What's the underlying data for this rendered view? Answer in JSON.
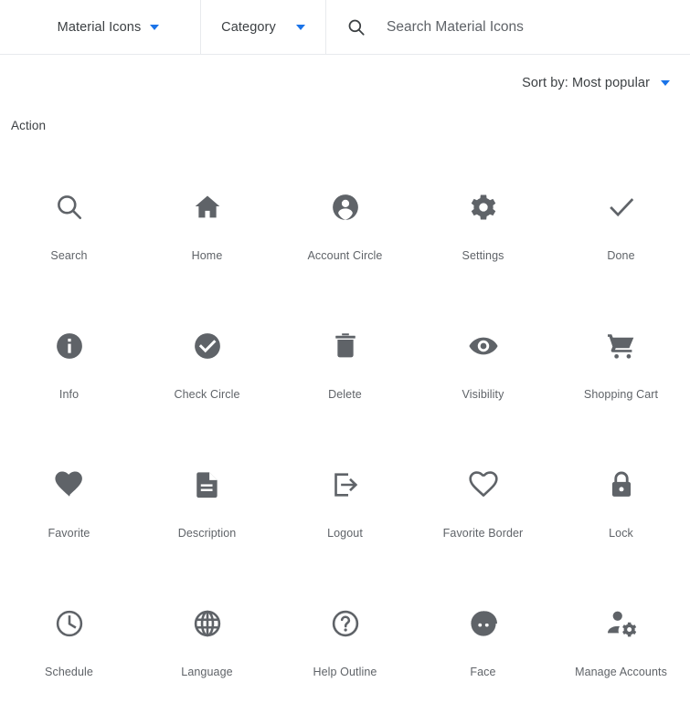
{
  "header": {
    "product_label": "Material Icons",
    "product_caret_icon": "chevron-down-icon",
    "category_label": "Category",
    "category_caret_icon": "chevron-down-icon",
    "search_icon": "search-icon",
    "search_value": "",
    "search_placeholder": "Search Material Icons"
  },
  "sort": {
    "label": "Sort by: Most popular",
    "caret_icon": "chevron-down-icon"
  },
  "section": {
    "title": "Action"
  },
  "colors": {
    "accent_blue": "#1a73e8",
    "icon_gray": "#5f6368",
    "text_gray": "#3c4043",
    "divider": "#e8eaed",
    "background": "#ffffff"
  },
  "icons": [
    {
      "label": "Search",
      "icon": "search-icon"
    },
    {
      "label": "Home",
      "icon": "home-icon"
    },
    {
      "label": "Account Circle",
      "icon": "account-circle-icon"
    },
    {
      "label": "Settings",
      "icon": "settings-gear-icon"
    },
    {
      "label": "Done",
      "icon": "checkmark-icon"
    },
    {
      "label": "Info",
      "icon": "info-filled-icon"
    },
    {
      "label": "Check Circle",
      "icon": "check-circle-filled-icon"
    },
    {
      "label": "Delete",
      "icon": "trash-can-icon"
    },
    {
      "label": "Visibility",
      "icon": "eye-icon"
    },
    {
      "label": "Shopping Cart",
      "icon": "shopping-cart-icon"
    },
    {
      "label": "Favorite",
      "icon": "heart-filled-icon"
    },
    {
      "label": "Description",
      "icon": "document-lines-icon"
    },
    {
      "label": "Logout",
      "icon": "logout-arrow-icon"
    },
    {
      "label": "Favorite Border",
      "icon": "heart-outline-icon"
    },
    {
      "label": "Lock",
      "icon": "lock-closed-icon"
    },
    {
      "label": "Schedule",
      "icon": "clock-icon"
    },
    {
      "label": "Language",
      "icon": "globe-icon"
    },
    {
      "label": "Help Outline",
      "icon": "question-mark-circle-icon"
    },
    {
      "label": "Face",
      "icon": "face-icon"
    },
    {
      "label": "Manage Accounts",
      "icon": "person-gear-icon"
    }
  ]
}
